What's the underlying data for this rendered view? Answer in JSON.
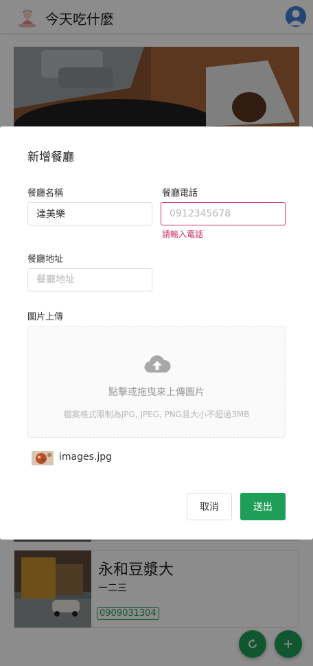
{
  "header": {
    "title": "今天吃什麼",
    "logo_icon": "chef-logo-icon",
    "avatar_icon": "user-avatar-icon"
  },
  "restaurant_card": {
    "name": "永和豆漿大",
    "address": "一二三",
    "phone": "0909031304"
  },
  "fabs": {
    "refresh_icon": "refresh-icon",
    "add_icon": "plus-icon"
  },
  "modal": {
    "title": "新增餐廳",
    "name_label": "餐廳名稱",
    "name_value": "達美樂",
    "phone_label": "餐廳電話",
    "phone_placeholder": "0912345678",
    "phone_error": "請輸入電話",
    "address_label": "餐廳地址",
    "address_placeholder": "餐廳地址",
    "upload_label": "圖片上傳",
    "upload_main": "點擊或拖曳來上傳圖片",
    "upload_hint": "檔案格式限制為JPG, JPEG, PNG且大小不超過3MB",
    "file_name": "images.jpg",
    "cancel_label": "取消",
    "submit_label": "送出"
  },
  "colors": {
    "primary": "#1e9e57",
    "error": "#c9305f"
  }
}
